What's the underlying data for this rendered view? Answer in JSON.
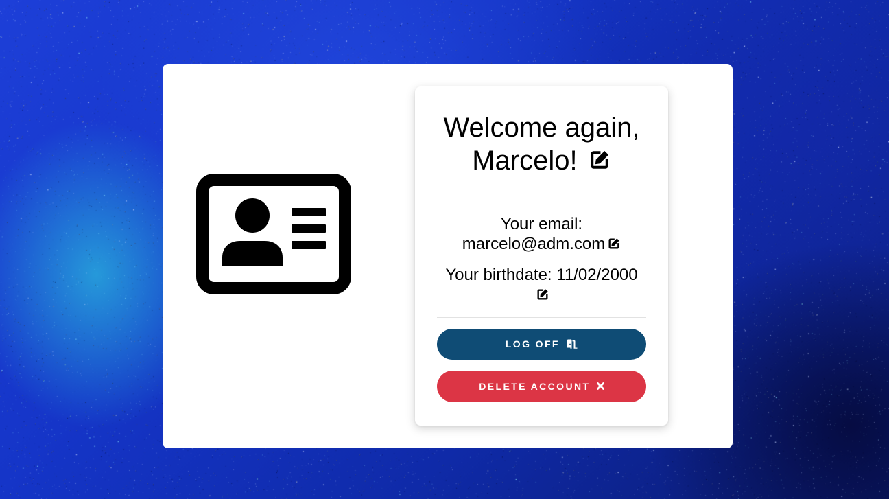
{
  "profile": {
    "greeting_line1": "Welcome again,",
    "greeting_line2": "Marcelo!",
    "email_label": "Your email:",
    "email_value": "marcelo@adm.com",
    "birthdate_label": "Your birthdate:",
    "birthdate_value": "11/02/2000"
  },
  "actions": {
    "logoff_label": "LOG OFF",
    "delete_label": "DELETE ACCOUNT"
  },
  "icons": {
    "profile_card": "id-card-icon",
    "edit": "edit-icon",
    "logoff": "door-icon",
    "delete": "x-icon"
  },
  "colors": {
    "logoff_button": "#0f4c75",
    "delete_button": "#dc3545",
    "panel": "#ffffff"
  }
}
